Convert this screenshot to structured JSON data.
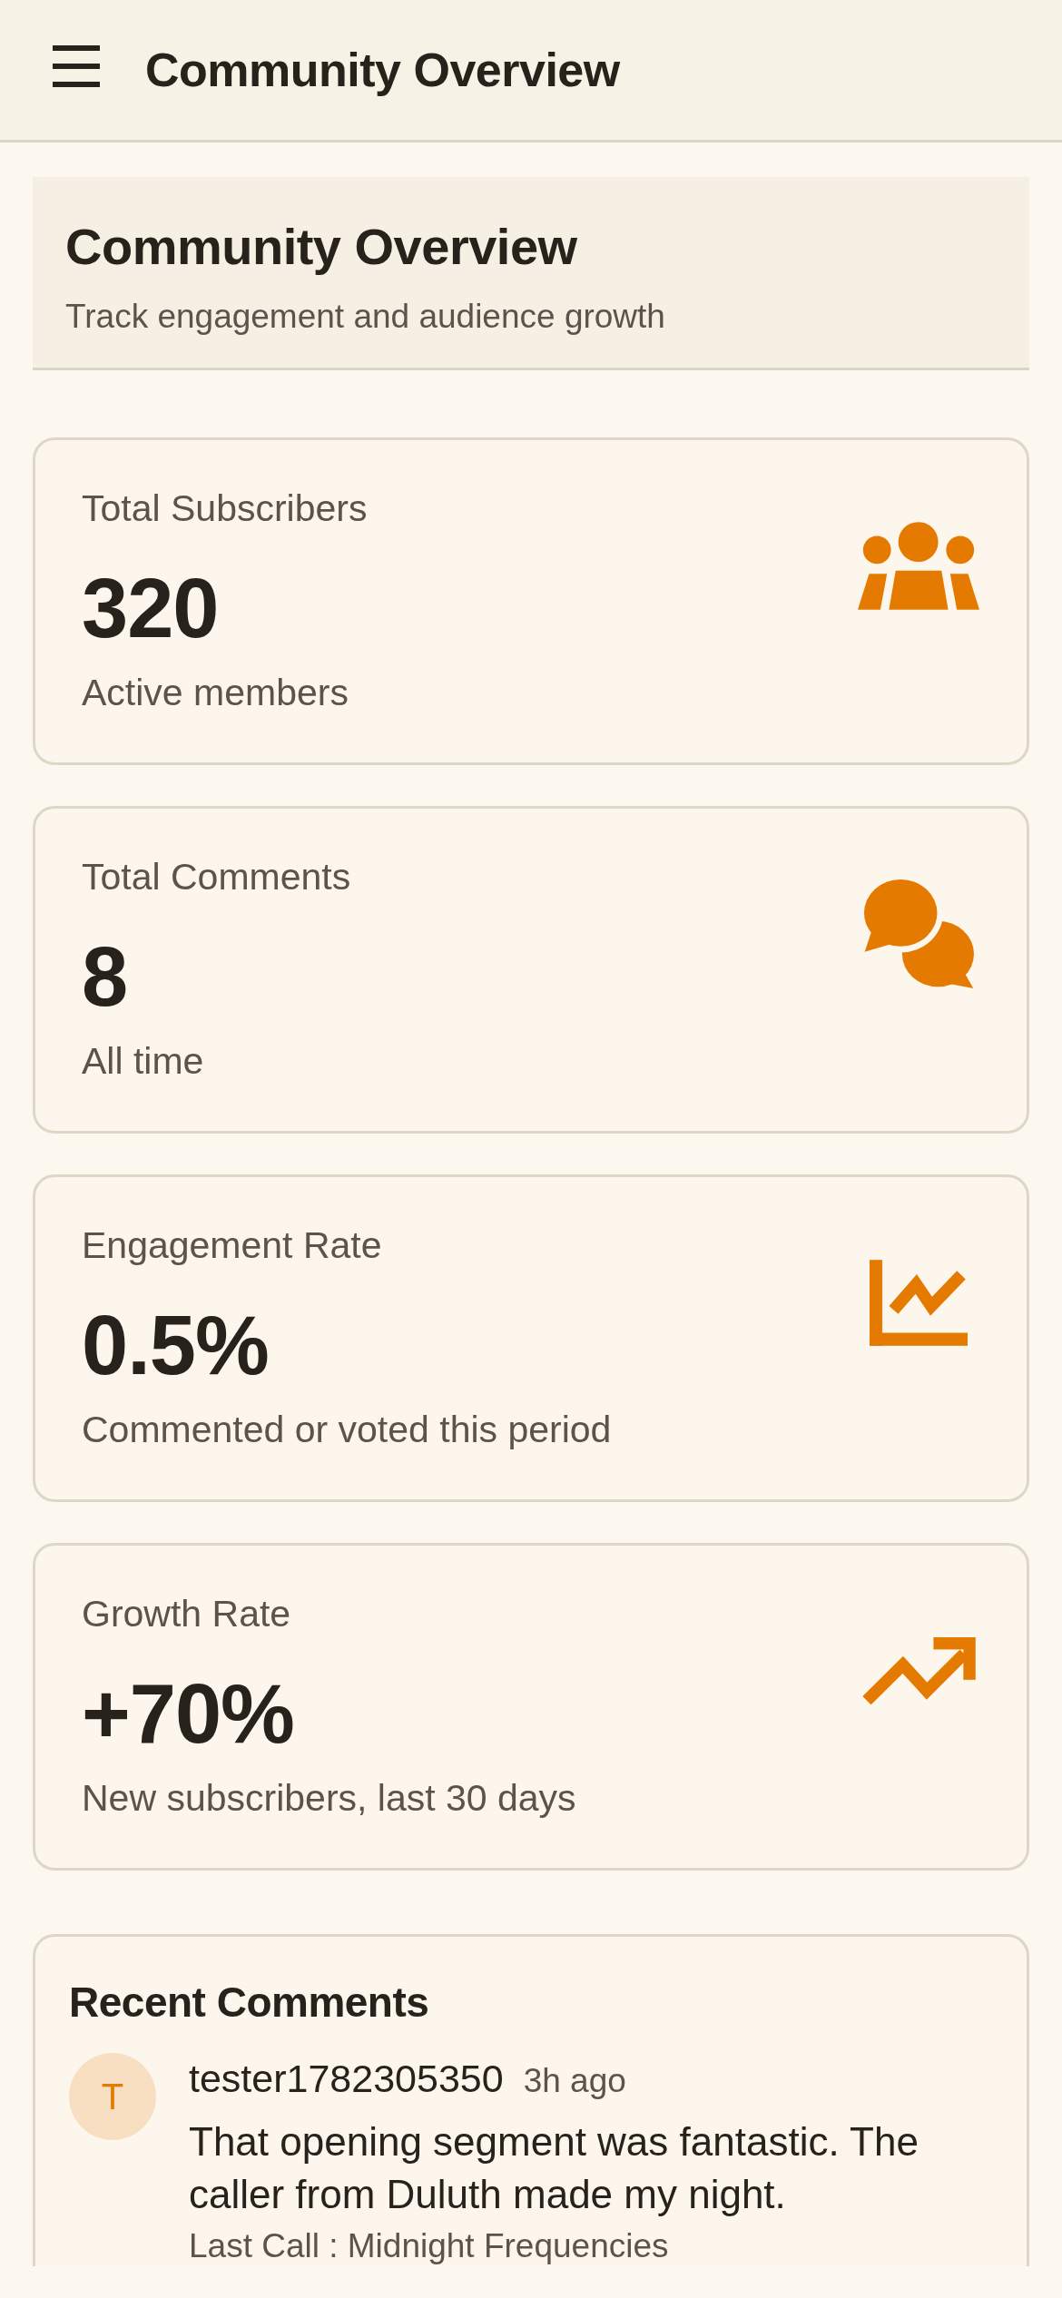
{
  "top_bar": {
    "title": "Community Overview"
  },
  "page_header": {
    "title": "Community Overview",
    "subtitle": "Track engagement and audience growth"
  },
  "stats": [
    {
      "kind": "subscribers",
      "label": "Total Subscribers",
      "value": "320",
      "caption": "Active members"
    },
    {
      "kind": "comments",
      "label": "Total Comments",
      "value": "8",
      "caption": "All time"
    },
    {
      "kind": "engagement",
      "label": "Engagement Rate",
      "value": "0.5%",
      "caption": "Commented or voted this period"
    },
    {
      "kind": "growth",
      "label": "Growth Rate",
      "value": "+70%",
      "caption": "New subscribers, last 30 days"
    }
  ],
  "recent_comments": {
    "title": "Recent Comments",
    "comments": [
      {
        "initial": "T",
        "author": "tester1782305350",
        "time": "3h ago",
        "text": "That opening segment was fantastic. The caller from Duluth made my night.",
        "source": "Last Call : Midnight Frequencies"
      }
    ]
  }
}
